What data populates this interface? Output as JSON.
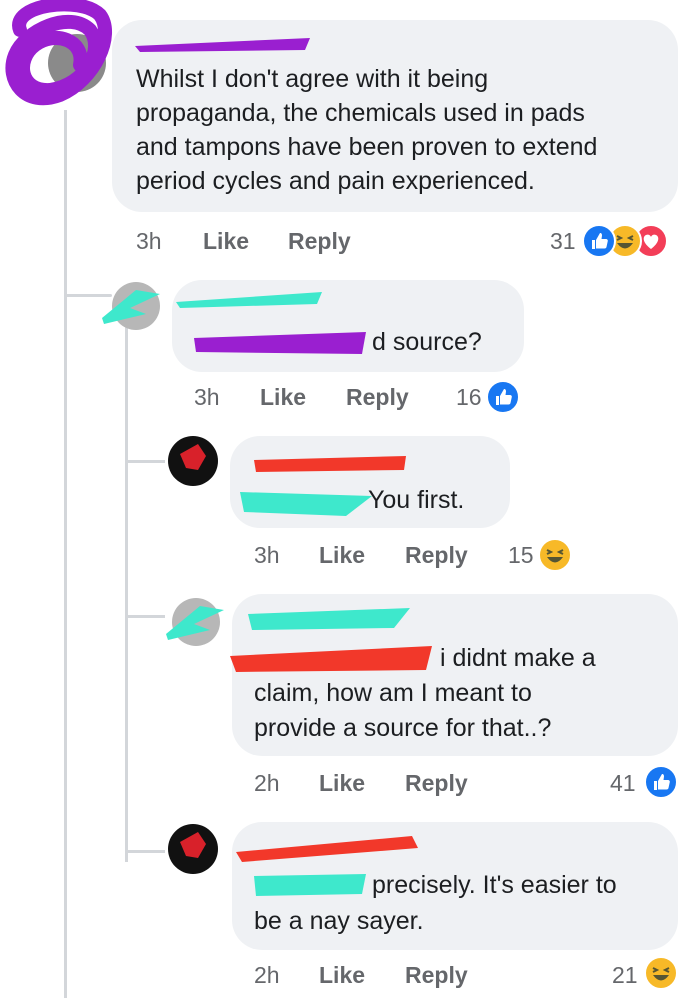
{
  "comments": [
    {
      "text_lines": [
        "Whilst I don't agree with it being",
        "propaganda, the chemicals used in pads",
        "and tampons have been proven to extend",
        "period cycles and pain experienced."
      ],
      "time": "3h",
      "like": "Like",
      "reply": "Reply",
      "reaction_count": "31",
      "reactions": [
        "like-icon",
        "haha-icon",
        "love-icon"
      ]
    },
    {
      "text_lines": [
        "d source?"
      ],
      "time": "3h",
      "like": "Like",
      "reply": "Reply",
      "reaction_count": "16",
      "reactions": [
        "like-icon"
      ]
    },
    {
      "text_lines": [
        "You first."
      ],
      "time": "3h",
      "like": "Like",
      "reply": "Reply",
      "reaction_count": "15",
      "reactions": [
        "haha-icon"
      ]
    },
    {
      "text_lines": [
        "i didnt make a",
        "claim, how am I meant to",
        "provide a source for that..?"
      ],
      "time": "2h",
      "like": "Like",
      "reply": "Reply",
      "reaction_count": "41",
      "reactions": [
        "like-icon"
      ]
    },
    {
      "text_lines": [
        "precisely. It's easier to",
        "be a nay sayer."
      ],
      "time": "2h",
      "like": "Like",
      "reply": "Reply",
      "reaction_count": "21",
      "reactions": [
        "haha-icon"
      ]
    }
  ],
  "colors": {
    "like_blue": "#1877f2",
    "haha_yellow": "#f7b928",
    "love_red": "#f33e58",
    "redact_purple": "#9a1fd0",
    "redact_cyan": "#3ee8cc",
    "redact_red": "#f2382a"
  }
}
